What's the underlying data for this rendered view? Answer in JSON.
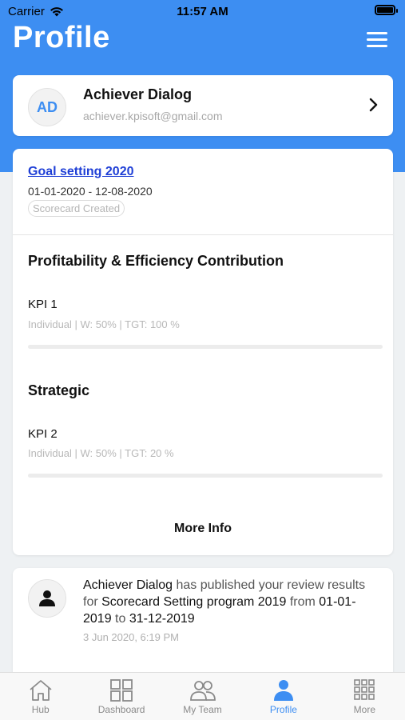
{
  "status_bar": {
    "carrier": "Carrier",
    "time": "11:57 AM"
  },
  "header": {
    "title": "Profile"
  },
  "user": {
    "initials": "AD",
    "name": "Achiever Dialog",
    "email": "achiever.kpisoft@gmail.com"
  },
  "goal": {
    "title": "Goal setting 2020",
    "dates": "01-01-2020 - 12-08-2020",
    "status": "Scorecard Created",
    "sections": [
      {
        "title": "Profitability & Efficiency Contribution",
        "kpi": "KPI 1",
        "meta": "Individual | W: 50% | TGT: 100 %",
        "progress": 0
      },
      {
        "title": "Strategic",
        "kpi": "KPI 2",
        "meta": "Individual | W: 50% | TGT: 20 %",
        "progress": 0
      }
    ],
    "more_info": "More Info"
  },
  "notification": {
    "actor": "Achiever Dialog",
    "text1": " has published your review results for ",
    "program": "Scorecard Setting program 2019",
    "text2": " from ",
    "from": "01-01-2019",
    "text3": " to ",
    "to": "31-12-2019",
    "time": "3 Jun 2020, 6:19 PM"
  },
  "tabs": [
    {
      "label": "Hub",
      "icon": "home-icon",
      "active": false
    },
    {
      "label": "Dashboard",
      "icon": "dashboard-icon",
      "active": false
    },
    {
      "label": "My Team",
      "icon": "team-icon",
      "active": false
    },
    {
      "label": "Profile",
      "icon": "profile-icon",
      "active": true
    },
    {
      "label": "More",
      "icon": "grid-icon",
      "active": false
    }
  ],
  "colors": {
    "accent": "#3d8ef2",
    "link": "#1f3fd6",
    "background": "#eef1f3"
  }
}
